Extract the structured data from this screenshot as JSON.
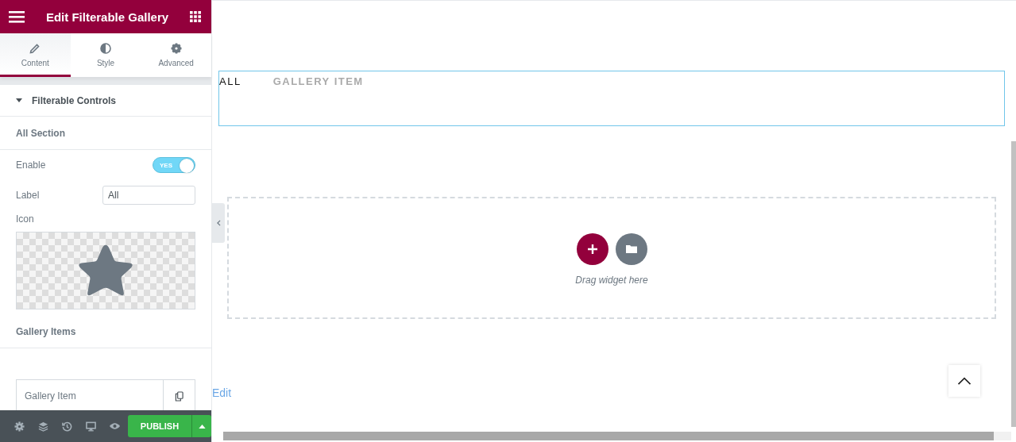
{
  "panel": {
    "title": "Edit Filterable Gallery",
    "tabs": [
      {
        "label": "Content",
        "selected": true
      },
      {
        "label": "Style",
        "selected": false
      },
      {
        "label": "Advanced",
        "selected": false
      }
    ],
    "section": {
      "title": "Filterable Controls",
      "expanded": true
    },
    "controls": [
      {
        "kind": "heading",
        "label": "All Section"
      },
      {
        "kind": "switch",
        "label": "Enable",
        "on": true,
        "text": "YES"
      },
      {
        "kind": "text",
        "label": "Label",
        "value": "All"
      },
      {
        "kind": "icon",
        "label": "Icon"
      },
      {
        "kind": "heading",
        "label": "Gallery Items"
      },
      {
        "kind": "repeater",
        "items": [
          "Gallery Item"
        ]
      }
    ],
    "publish": "PUBLISH"
  },
  "preview": {
    "filters": [
      {
        "label": "ALL",
        "selected": true
      },
      {
        "label": "GALLERY ITEM",
        "selected": false
      }
    ],
    "dropzone": "Drag widget here",
    "edit_link": "Edit"
  }
}
